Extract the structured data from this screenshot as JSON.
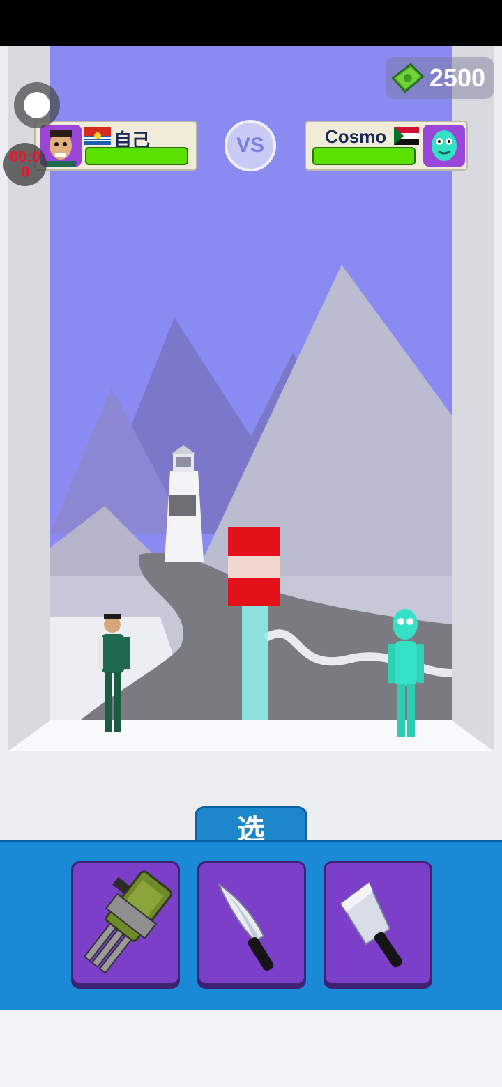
{
  "hud": {
    "coins": "2500",
    "timer": "00:0\n0",
    "vs_label": "VS",
    "select_label": "选"
  },
  "players": {
    "self": {
      "name": "自己",
      "health": 1.0
    },
    "opponent": {
      "name": "Cosmo",
      "health": 1.0
    }
  },
  "weapons": [
    {
      "name": "minigun"
    },
    {
      "name": "kitchen knife"
    },
    {
      "name": "cleaver"
    }
  ],
  "colors": {
    "sky": "#8a8bf2",
    "tray": "#1b8ad6",
    "weapon_slot": "#7b3fc9",
    "health": "#5be100",
    "barrel_red": "#e4111b"
  }
}
